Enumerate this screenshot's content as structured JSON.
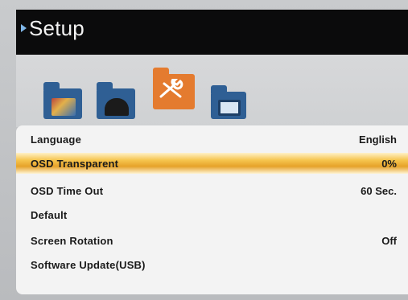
{
  "window": {
    "title": "Setup"
  },
  "icons": [
    {
      "name": "picture-folder-icon"
    },
    {
      "name": "sound-folder-icon"
    },
    {
      "name": "setup-folder-icon",
      "selected": true
    },
    {
      "name": "screen-folder-icon"
    }
  ],
  "menu": {
    "items": [
      {
        "label": "Language",
        "value": "English",
        "highlighted": false
      },
      {
        "label": "OSD Transparent",
        "value": "0%",
        "highlighted": true
      },
      {
        "label": "OSD Time Out",
        "value": "60 Sec.",
        "highlighted": false
      },
      {
        "label": "Default",
        "value": "",
        "highlighted": false
      },
      {
        "label": "Screen Rotation",
        "value": "Off",
        "highlighted": false
      },
      {
        "label": "Software Update(USB)",
        "value": "",
        "highlighted": false
      }
    ]
  },
  "colors": {
    "title_bar": "#0b0b0c",
    "highlight": "#f6c54e",
    "folder_blue": "#2f5f94",
    "folder_orange": "#e47b2f"
  }
}
